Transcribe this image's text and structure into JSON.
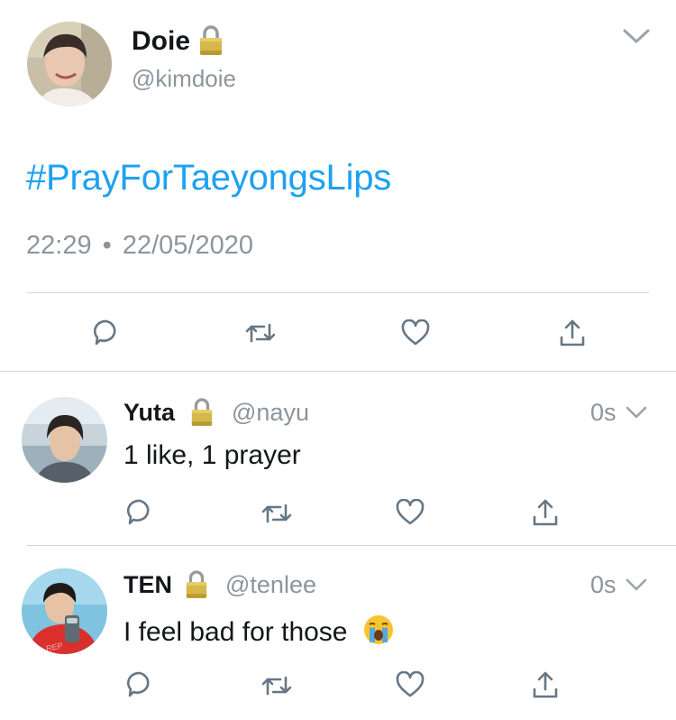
{
  "main_tweet": {
    "author_name": "Doie",
    "author_handle": "@kimdoie",
    "lock_icon": "padlock-icon",
    "text": "#PrayForTaeyongsLips",
    "time": "22:29",
    "separator": "•",
    "date": "22/05/2020",
    "actions": [
      "reply-icon",
      "retweet-icon",
      "like-icon",
      "share-icon"
    ],
    "link_color": "#1da1f2"
  },
  "replies": [
    {
      "author_name": "Yuta",
      "author_handle": "@nayu",
      "time": "0s",
      "text": "1 like, 1 prayer"
    },
    {
      "author_name": "TEN",
      "author_handle": "@tenlee",
      "time": "0s",
      "text": "I feel bad for those",
      "emoji": "😭"
    }
  ],
  "colors": {
    "text_primary": "#14171a",
    "text_secondary": "#8c959d",
    "icon_gray": "#657786",
    "divider": "#cfd4d8"
  }
}
